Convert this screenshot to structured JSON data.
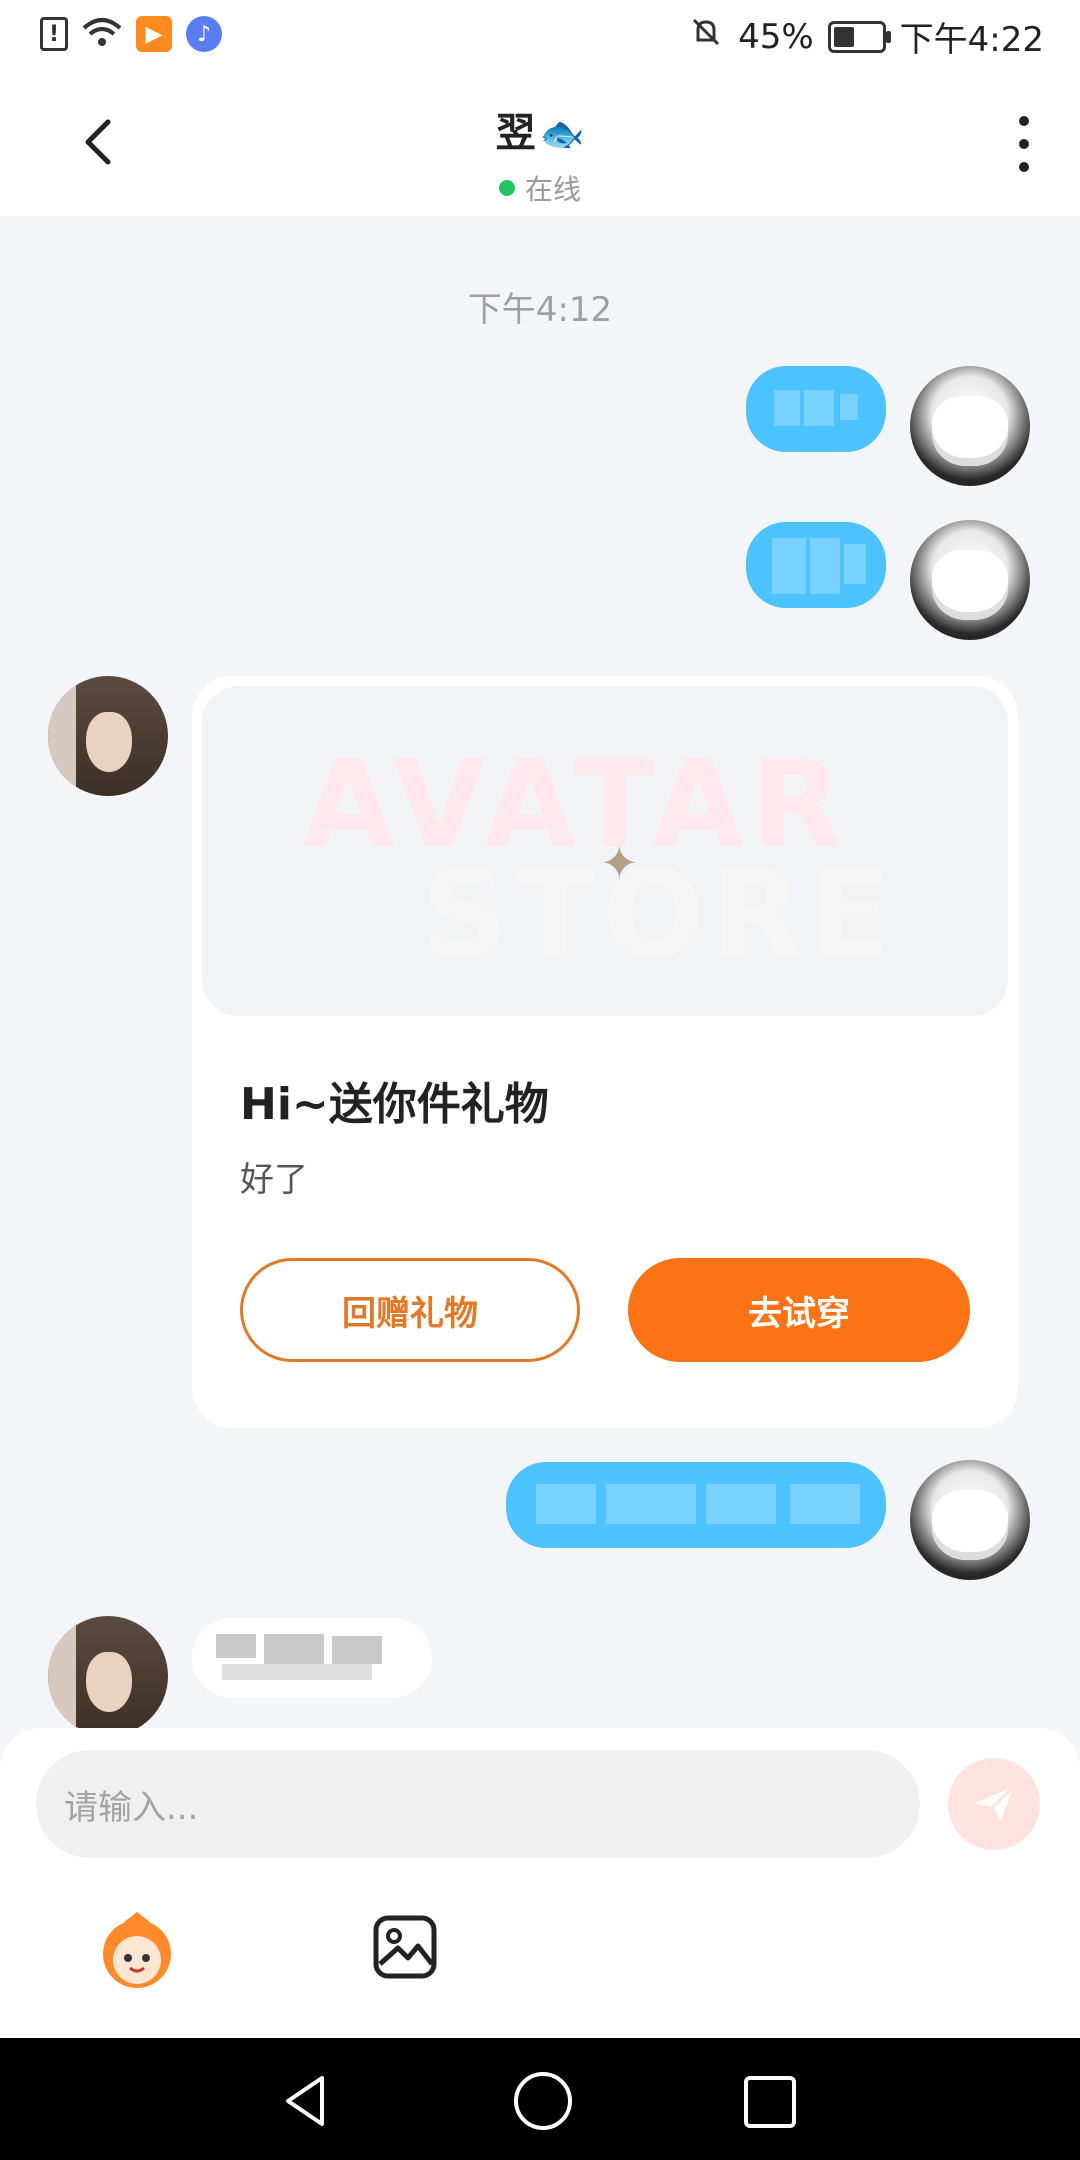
{
  "status_bar": {
    "time": "下午4:22",
    "battery": "45%",
    "battery_fraction": 0.45,
    "left_icons": [
      "alert-icon",
      "wifi-icon",
      "video-app-icon",
      "music-app-icon"
    ],
    "right_icons": [
      "mute-bell-icon",
      "battery-icon"
    ]
  },
  "header": {
    "title": "翌",
    "title_emoji": "🐟",
    "status": "在线"
  },
  "chat": {
    "timestamp": "下午4:12",
    "gift_card": {
      "watermark_line1": "AVATAR",
      "watermark_line2": "STORE",
      "title": "Hi~送你件礼物",
      "subtitle": "好了",
      "return_gift_label": "回赠礼物",
      "try_on_label": "去试穿"
    }
  },
  "composer": {
    "placeholder": "请输入..."
  },
  "colors": {
    "accent_orange": "#fb7315",
    "bubble_blue": "#4cc2ff",
    "online_green": "#22c55e"
  }
}
